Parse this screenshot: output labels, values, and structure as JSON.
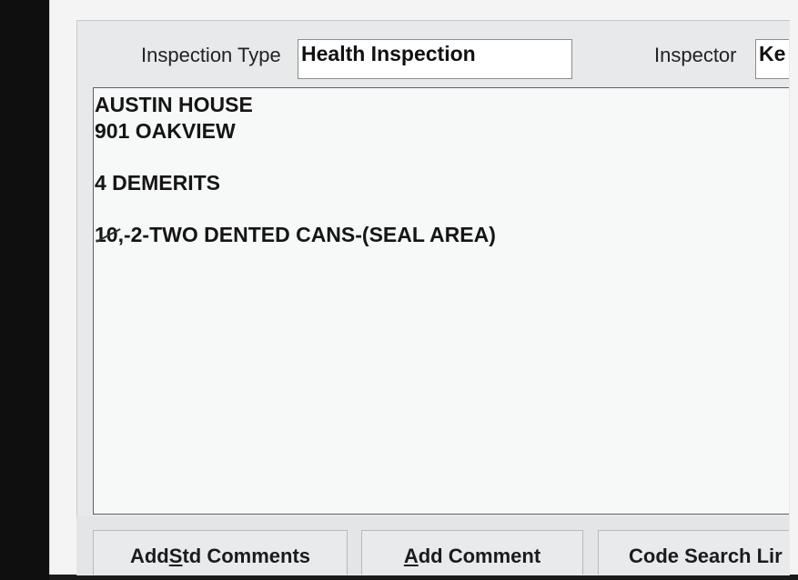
{
  "form": {
    "inspection_type_label": "Inspection Type",
    "inspection_type_value": "Health Inspection",
    "inspector_label": "Inspector",
    "inspector_value": "Ke"
  },
  "comments": {
    "lines": [
      "AUSTIN HOUSE",
      "901 OAKVIEW",
      "",
      "4 DEMERITS",
      "",
      "-2-TWO DENTED CANS-(SEAL AREA)"
    ],
    "struck_prefix": "10,"
  },
  "buttons": {
    "add_std_pre": "Add ",
    "add_std_u": "S",
    "add_std_post": "td Comments",
    "add_comment_u": "A",
    "add_comment_post": "dd Comment",
    "code_search": "Code Search Lir"
  }
}
